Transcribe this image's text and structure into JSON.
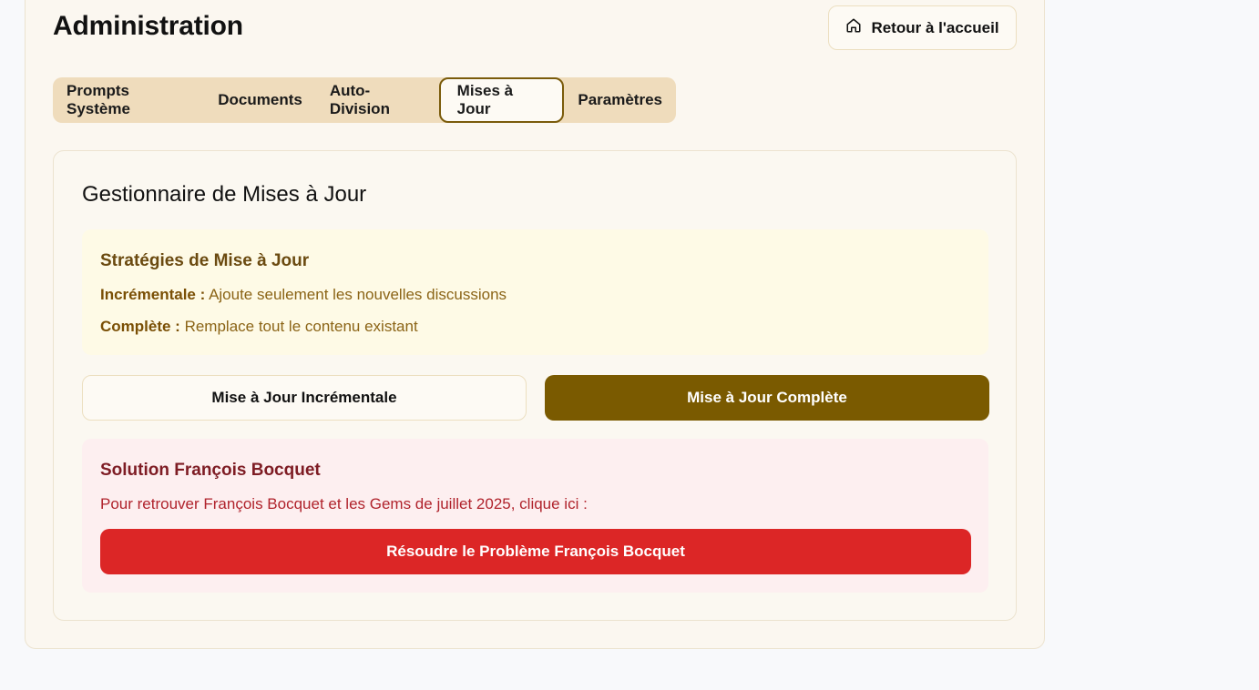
{
  "header": {
    "title": "Administration",
    "home_button": {
      "label": "Retour à l'accueil",
      "icon": "home-icon"
    }
  },
  "tabs": [
    {
      "label": "Prompts Système",
      "active": false
    },
    {
      "label": "Documents",
      "active": false
    },
    {
      "label": "Auto-Division",
      "active": false
    },
    {
      "label": "Mises à Jour",
      "active": true
    },
    {
      "label": "Paramètres",
      "active": false
    }
  ],
  "manager": {
    "title": "Gestionnaire de Mises à Jour",
    "strategies": {
      "title": "Stratégies de Mise à Jour",
      "incremental": {
        "term": "Incrémentale :",
        "desc": "Ajoute seulement les nouvelles discussions"
      },
      "complete": {
        "term": "Complète :",
        "desc": "Remplace tout le contenu existant"
      }
    },
    "buttons": {
      "incremental": "Mise à Jour Incrémentale",
      "complete": "Mise à Jour Complète"
    },
    "solution": {
      "title": "Solution François Bocquet",
      "text": "Pour retrouver François Bocquet et les Gems de juillet 2025, clique ici :",
      "button": "Résoudre le Problème François Bocquet"
    }
  },
  "colors": {
    "accent_brown": "#7a5a00",
    "danger_red": "#dc2626",
    "tab_bar": "#efdcbc"
  }
}
